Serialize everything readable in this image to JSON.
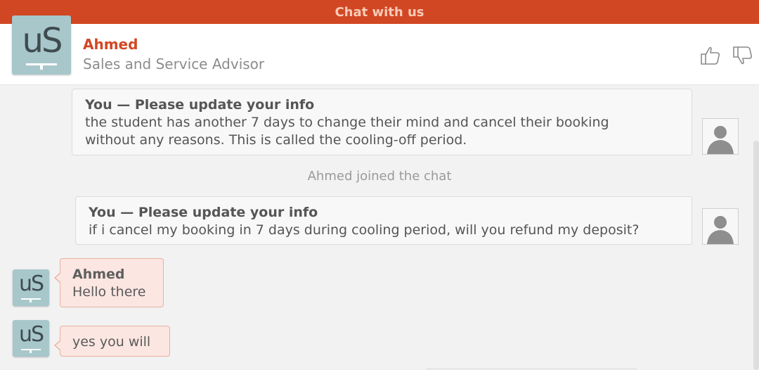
{
  "window": {
    "title": "Chat with us"
  },
  "colors": {
    "brand": "#d24723",
    "agent_bubble": "#fbe6e1",
    "user_bubble": "#f8f8f8",
    "logo_bg": "#a7c7cb"
  },
  "agent": {
    "name": "Ahmed",
    "role": "Sales and Service Advisor",
    "logo_text": "uS",
    "rate_up_icon": "thumbs-up-icon",
    "rate_down_icon": "thumbs-down-icon"
  },
  "messages": [
    {
      "sender": "You — Please update your info",
      "text_line1": "the student has another 7 days to change their mind and cancel their booking",
      "text_line2": "without any reasons. This is called the cooling-off period.",
      "avatar_icon": "user-silhouette-icon"
    },
    {
      "system": "Ahmed joined the chat"
    },
    {
      "sender": "You — Please update your info",
      "text": "if i cancel my booking in 7 days during cooling period, will you refund my deposit?",
      "avatar_icon": "user-silhouette-icon"
    },
    {
      "sender": "Ahmed",
      "text": "Hello there",
      "avatar_text": "uS"
    },
    {
      "text": "yes you will",
      "avatar_text": "uS"
    }
  ]
}
